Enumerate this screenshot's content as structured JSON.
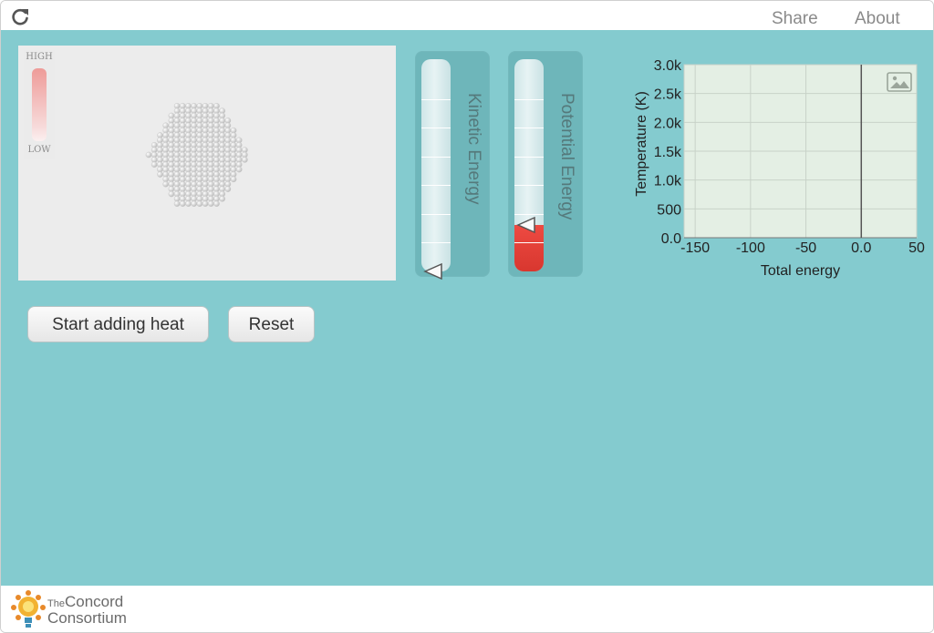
{
  "topbar": {
    "share_label": "Share",
    "about_label": "About"
  },
  "simulation": {
    "heat_high": "HIGH",
    "heat_low": "LOW"
  },
  "energy_bars": {
    "kinetic_label": "Kinetic Energy",
    "kinetic_level": 0.0,
    "potential_label": "Potential Energy",
    "potential_level": 0.22
  },
  "buttons": {
    "start_heat_label": "Start adding heat",
    "reset_label": "Reset"
  },
  "chart_data": {
    "type": "line",
    "xlabel": "Total energy",
    "ylabel": "Temperature (K)",
    "xlim": [
      -160,
      50
    ],
    "ylim": [
      0,
      3000
    ],
    "x_ticks": [
      "-150",
      "-100",
      "-50",
      "0.0",
      "50"
    ],
    "x_tick_values": [
      -150,
      -100,
      -50,
      0,
      50
    ],
    "y_ticks": [
      "0.0",
      "500",
      "1.0k",
      "1.5k",
      "2.0k",
      "2.5k",
      "3.0k"
    ],
    "y_tick_values": [
      0,
      500,
      1000,
      1500,
      2000,
      2500,
      3000
    ],
    "grid": true,
    "series": [],
    "current_energy_marker": 0,
    "colors": {
      "plot_bg": "#e4efe4",
      "grid": "#c8d2c8",
      "marker": "#555555"
    }
  },
  "footer": {
    "logo_small": "The",
    "logo_word1": "Concord",
    "logo_word2": "Consortium"
  },
  "colors": {
    "main_bg": "#84cbcf",
    "sim_bg": "#ececec",
    "potential_fill": "#e5413a"
  }
}
